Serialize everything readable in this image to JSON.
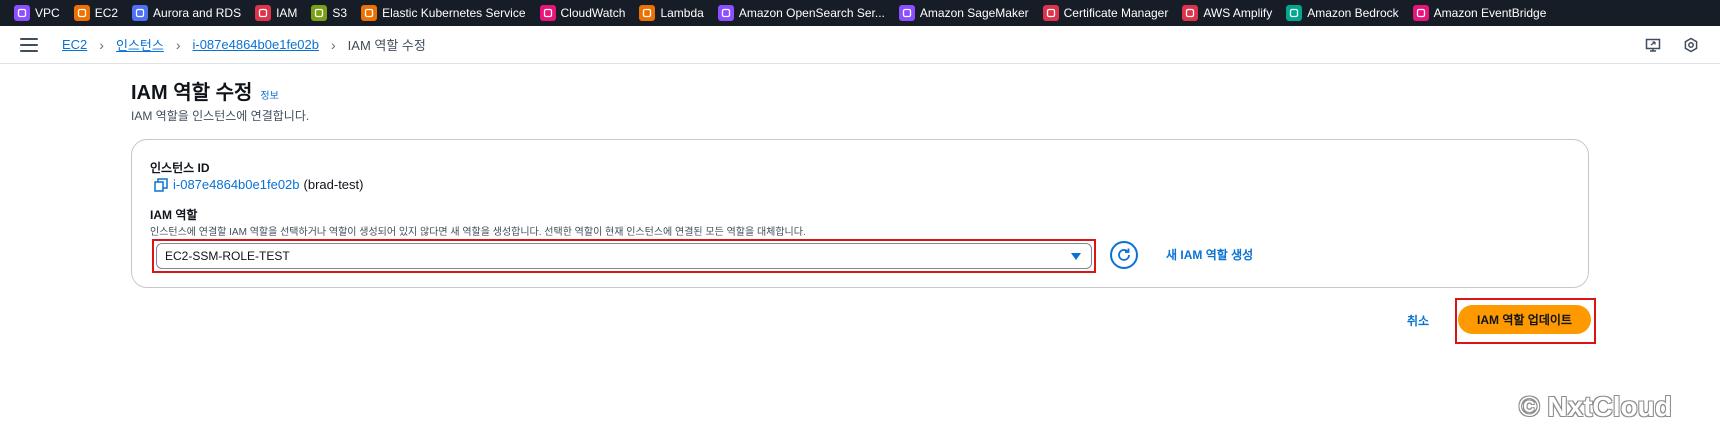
{
  "favorites": [
    {
      "label": "VPC",
      "icon": "vpc-icon",
      "color": "#8c4fff"
    },
    {
      "label": "EC2",
      "icon": "ec2-icon",
      "color": "#ed7100"
    },
    {
      "label": "Aurora and RDS",
      "icon": "rds-icon",
      "color": "#4d72f3"
    },
    {
      "label": "IAM",
      "icon": "iam-icon",
      "color": "#dd344c"
    },
    {
      "label": "S3",
      "icon": "s3-icon",
      "color": "#7aa116"
    },
    {
      "label": "Elastic Kubernetes Service",
      "icon": "eks-icon",
      "color": "#ed7100"
    },
    {
      "label": "CloudWatch",
      "icon": "cloudwatch-icon",
      "color": "#e7157b"
    },
    {
      "label": "Lambda",
      "icon": "lambda-icon",
      "color": "#ed7100"
    },
    {
      "label": "Amazon OpenSearch Ser...",
      "icon": "opensearch-icon",
      "color": "#8c4fff"
    },
    {
      "label": "Amazon SageMaker",
      "icon": "sagemaker-icon",
      "color": "#8c4fff"
    },
    {
      "label": "Certificate Manager",
      "icon": "certificate-icon",
      "color": "#dd344c"
    },
    {
      "label": "AWS Amplify",
      "icon": "amplify-icon",
      "color": "#dd344c"
    },
    {
      "label": "Amazon Bedrock",
      "icon": "bedrock-icon",
      "color": "#01a88d"
    },
    {
      "label": "Amazon EventBridge",
      "icon": "eventbridge-icon",
      "color": "#e7157b"
    }
  ],
  "breadcrumb": {
    "items": [
      "EC2",
      "인스턴스",
      "i-087e4864b0e1fe02b"
    ],
    "current": "IAM 역할 수정"
  },
  "header": {
    "title": "IAM 역할 수정",
    "info": "정보",
    "description": "IAM 역할을 인스턴스에 연결합니다."
  },
  "form": {
    "instance_label": "인스턴스 ID",
    "instance_id": "i-087e4864b0e1fe02b",
    "instance_name": "(brad-test)",
    "role_label": "IAM 역할",
    "role_description": "인스턴스에 연결할 IAM 역할을 선택하거나 역할이 생성되어 있지 않다면 새 역할을 생성합니다. 선택한 역할이 현재 인스턴스에 연결된 모든 역할을 대체합니다.",
    "role_selected": "EC2-SSM-ROLE-TEST",
    "create_role_link": "새 IAM 역할 생성"
  },
  "actions": {
    "cancel": "취소",
    "update": "IAM 역할 업데이트"
  },
  "watermark": "© NxtCloud",
  "colors": {
    "link": "#0972d3",
    "primary_button": "#ff9900",
    "highlight_frame": "#d91515",
    "nav_bg": "#161d26"
  }
}
